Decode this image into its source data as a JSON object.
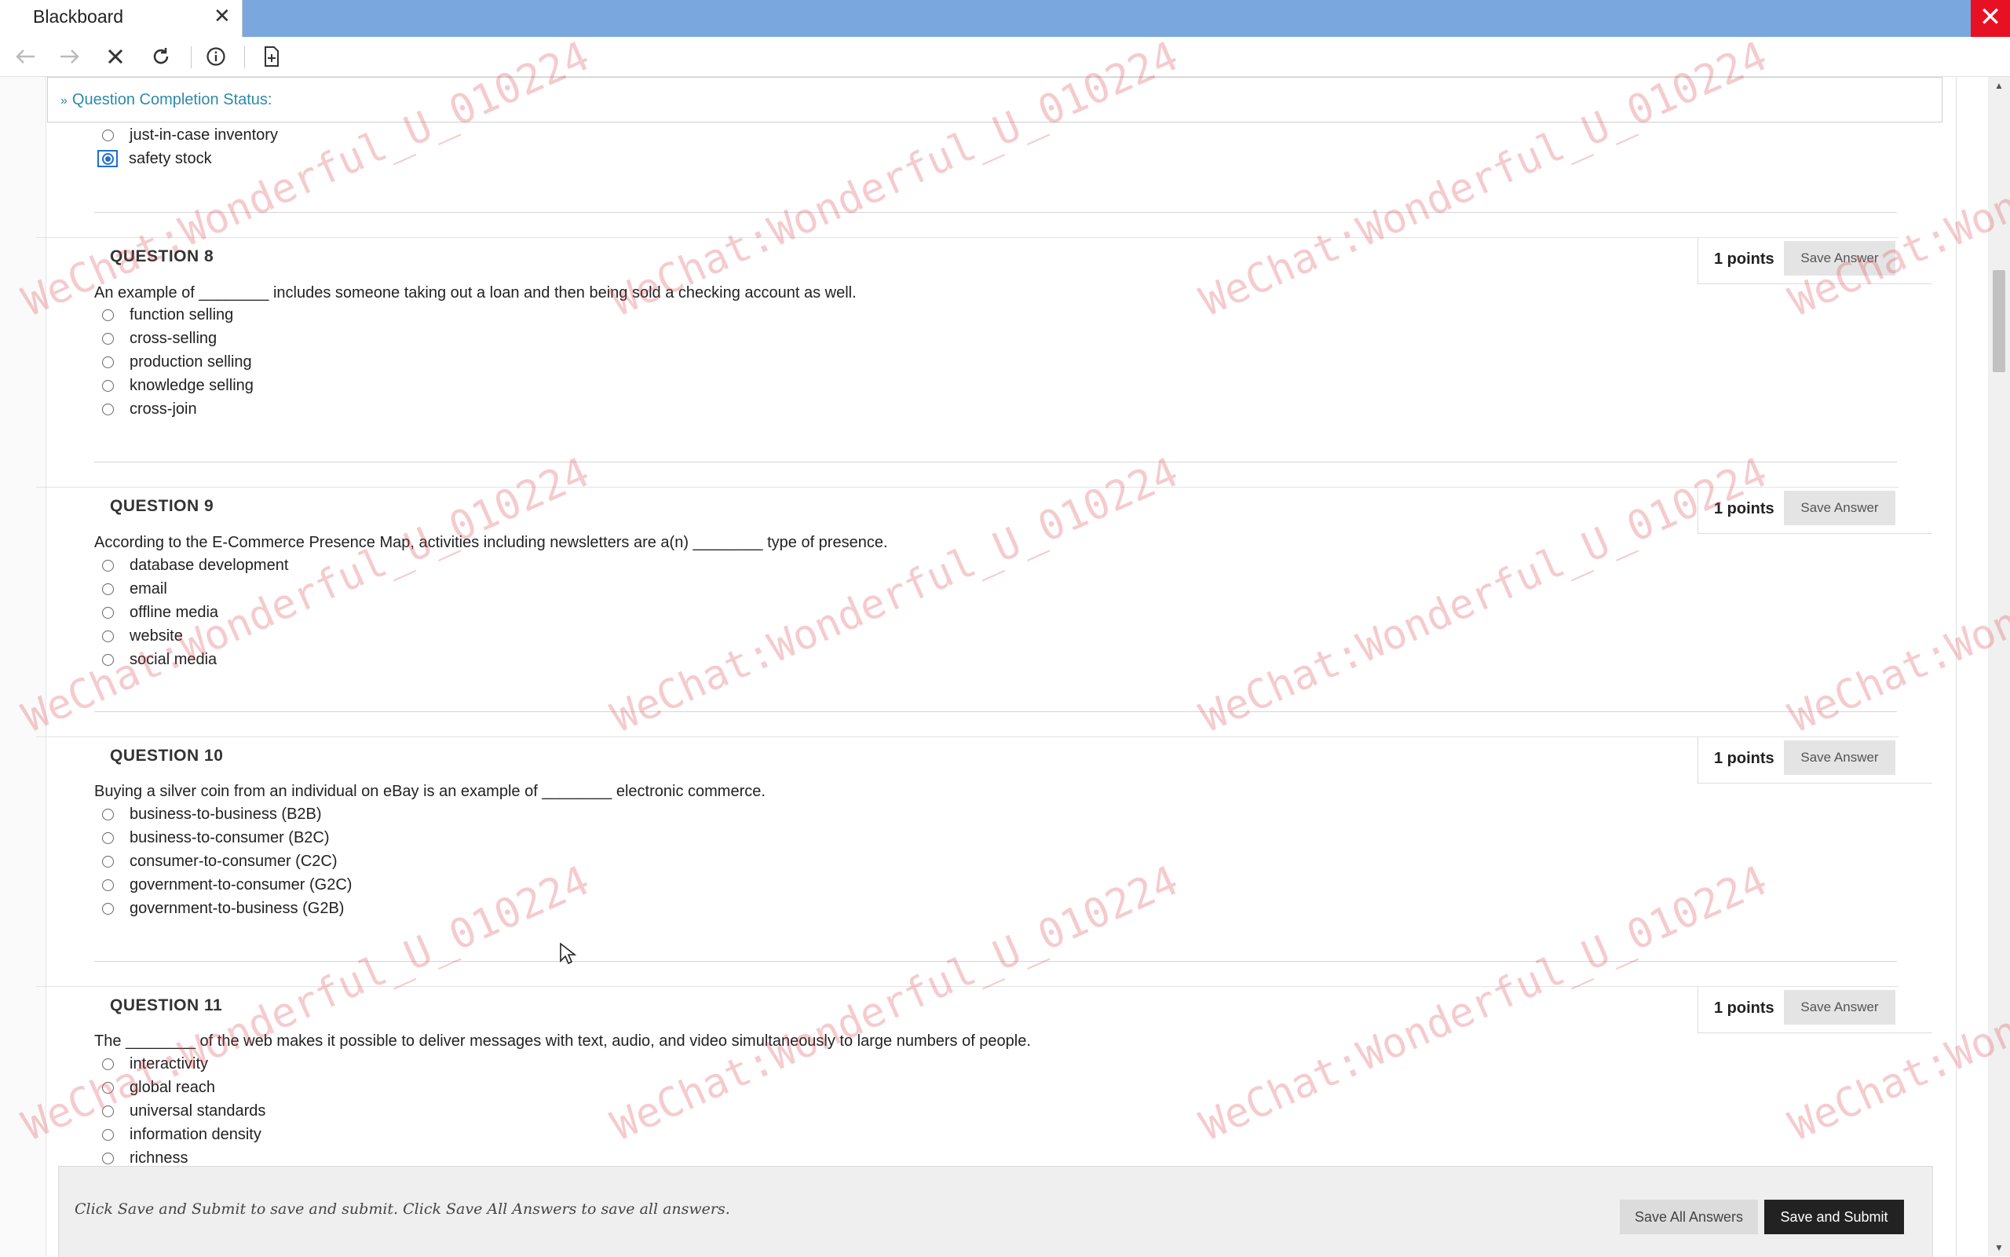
{
  "window": {
    "tab_title": "Blackboard",
    "tab_close": "✕",
    "close_glyph": "✕"
  },
  "toolbar": {
    "icons": [
      "back-arrow-icon",
      "forward-arrow-icon",
      "stop-icon",
      "refresh-icon",
      "info-icon",
      "page-icon"
    ]
  },
  "status": {
    "label": "Question Completion Status:"
  },
  "previous_question": {
    "options": [
      {
        "label": "just-in-case inventory",
        "selected": false
      },
      {
        "label": "safety stock",
        "selected": true
      }
    ]
  },
  "questions": [
    {
      "title": "QUESTION 8",
      "points": "1 points",
      "save_label": "Save Answer",
      "text": "An example of ________ includes someone taking out a loan and then being sold a checking account as well.",
      "options": [
        "function selling",
        "cross-selling",
        "production selling",
        "knowledge selling",
        "cross-join"
      ]
    },
    {
      "title": "QUESTION 9",
      "points": "1 points",
      "save_label": "Save Answer",
      "text": "According to the E-Commerce Presence Map, activities including newsletters are a(n) ________ type of presence.",
      "options": [
        "database development",
        "email",
        "offline media",
        "website",
        "social media"
      ]
    },
    {
      "title": "QUESTION 10",
      "points": "1 points",
      "save_label": "Save Answer",
      "text": "Buying a silver coin from an individual on eBay is an example of ________ electronic commerce.",
      "options": [
        "business-to-business (B2B)",
        "business-to-consumer (B2C)",
        "consumer-to-consumer (C2C)",
        "government-to-consumer (G2C)",
        "government-to-business (G2B)"
      ]
    },
    {
      "title": "QUESTION 11",
      "points": "1 points",
      "save_label": "Save Answer",
      "text": "The ________ of the web makes it possible to deliver messages with text, audio, and video simultaneously to large numbers of people.",
      "options": [
        "interactivity",
        "global reach",
        "universal standards",
        "information density",
        "richness"
      ]
    }
  ],
  "footer": {
    "instructions": "Click Save and Submit to save and submit. Click Save All Answers to save all answers.",
    "save_all_label": "Save All Answers",
    "submit_label": "Save and Submit"
  },
  "watermark": {
    "text": "WeChat:Wonderful_U_010224",
    "partial_text": "WeChat:Wonde"
  },
  "colors": {
    "titlebar": "#7aa7de",
    "link": "#2d8aa8",
    "selected_radio": "#1f6fd1",
    "close_red": "#e81123",
    "submit_bg": "#222222"
  }
}
